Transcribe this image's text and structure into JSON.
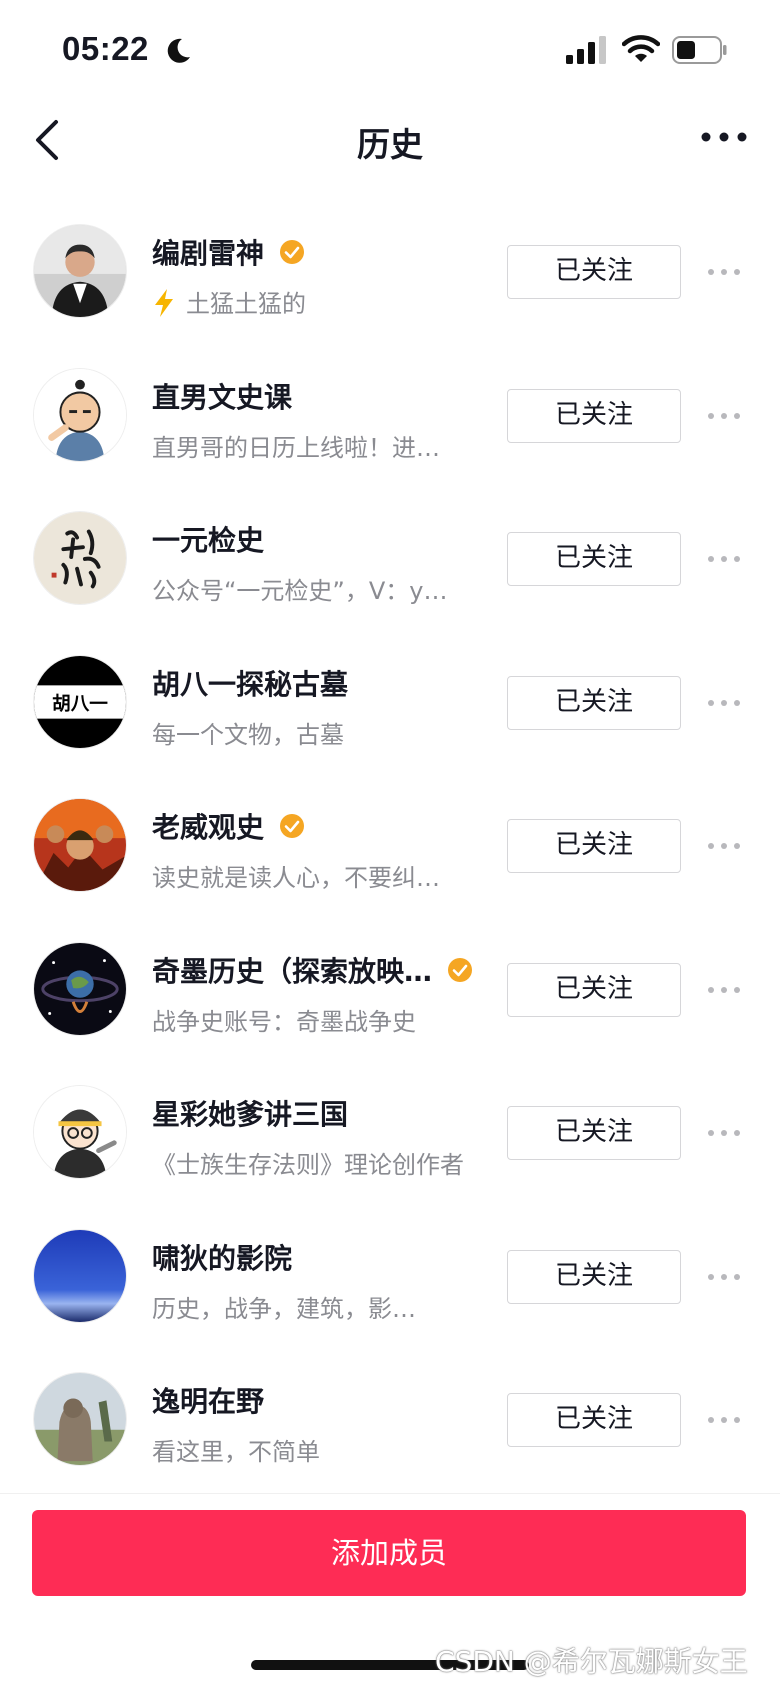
{
  "status_bar": {
    "time": "05:22"
  },
  "header": {
    "title": "历史"
  },
  "colors": {
    "accent": "#fe2c55",
    "verified": "#f5a623",
    "secondary_text": "#8a8b91"
  },
  "members": [
    {
      "name": "编剧雷神",
      "verified": true,
      "desc": "土猛土猛的",
      "desc_icon": "lightning-icon",
      "follow_label": "已关注"
    },
    {
      "name": "直男文史课",
      "verified": false,
      "desc": "直男哥的日历上线啦！进…",
      "follow_label": "已关注"
    },
    {
      "name": "一元检史",
      "verified": false,
      "desc": "公众号“一元检史”，V：y…",
      "follow_label": "已关注"
    },
    {
      "name": "胡八一探秘古墓",
      "verified": false,
      "desc": "每一个文物，古墓",
      "avatar_text": "胡八一",
      "follow_label": "已关注"
    },
    {
      "name": "老威观史",
      "verified": true,
      "desc": "读史就是读人心，不要纠…",
      "follow_label": "已关注"
    },
    {
      "name": "奇墨历史（探索放映…",
      "verified": true,
      "desc": "战争史账号：奇墨战争史",
      "follow_label": "已关注"
    },
    {
      "name": "星彩她爹讲三国",
      "verified": false,
      "desc": "《士族生存法则》理论创作者",
      "follow_label": "已关注"
    },
    {
      "name": "啸狄的影院",
      "verified": false,
      "desc": "历史，战争，建筑，影…",
      "follow_label": "已关注"
    },
    {
      "name": "逸明在野",
      "verified": false,
      "desc": "看这里，不简单",
      "follow_label": "已关注"
    }
  ],
  "footer": {
    "add_button_label": "添加成员"
  },
  "watermark": "CSDN @希尔瓦娜斯女王"
}
